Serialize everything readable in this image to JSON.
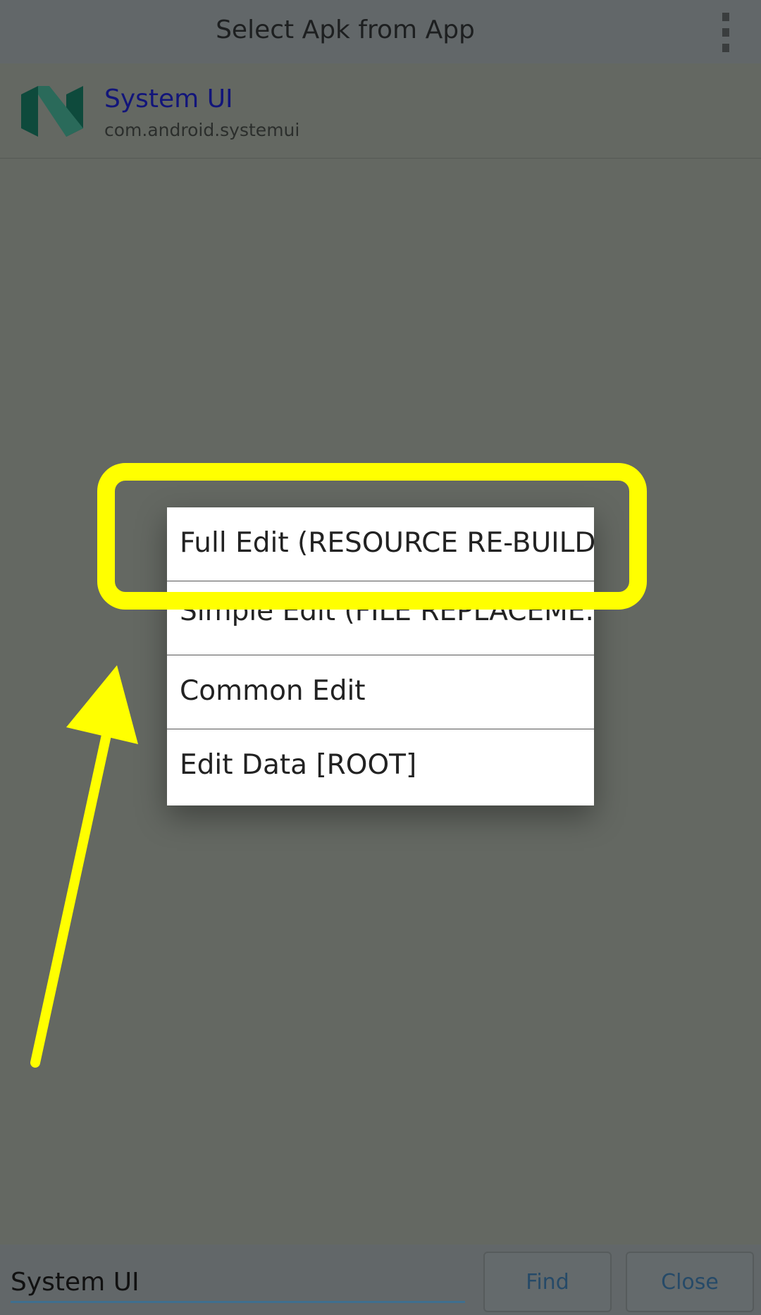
{
  "app_bar": {
    "title": "Select Apk from App",
    "menu_icon": "more-vert-icon"
  },
  "app": {
    "name": "System UI",
    "package": "com.android.systemui",
    "icon": "android-n-logo-icon"
  },
  "menu": {
    "items": [
      {
        "label": "Full Edit (RESOURCE RE-BUILD)"
      },
      {
        "label": "Simple Edit (FILE REPLACEME..."
      },
      {
        "label": "Common Edit"
      },
      {
        "label": "Edit Data [ROOT]"
      }
    ]
  },
  "annotation": {
    "color": "#ffff00"
  },
  "bottom": {
    "search_value": "System UI",
    "find_label": "Find",
    "close_label": "Close"
  }
}
